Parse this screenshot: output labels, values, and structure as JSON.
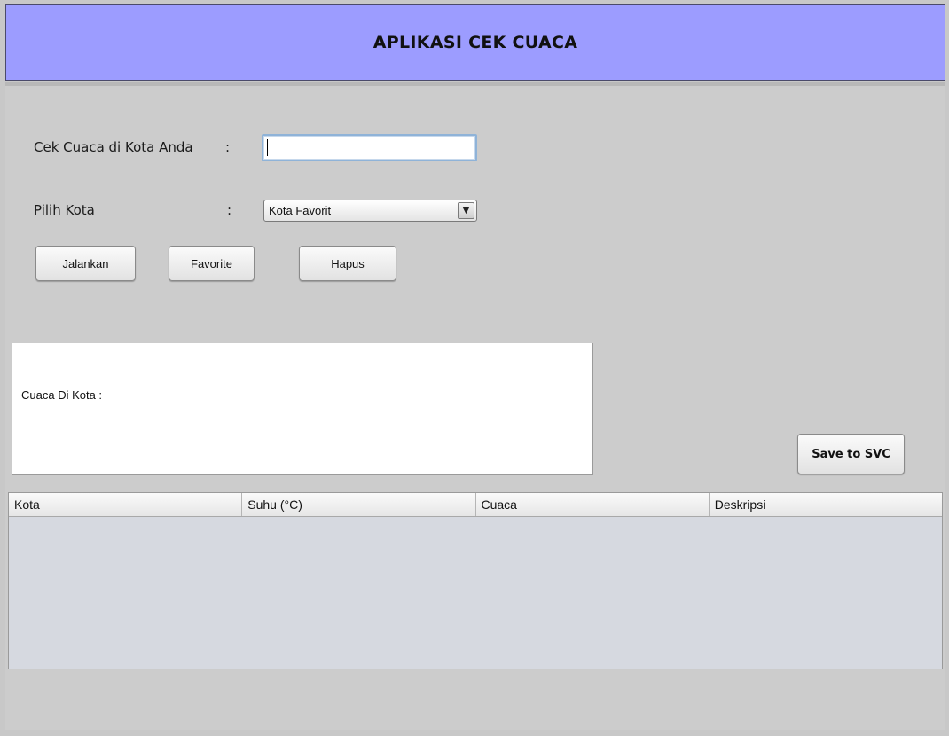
{
  "app": {
    "title": "APLIKASI CEK CUACA"
  },
  "form": {
    "city_label": "Cek Cuaca di Kota Anda",
    "city_colon": ":",
    "city_value": "",
    "pick_label": "Pilih Kota",
    "pick_colon": ":",
    "pick_selected": "Kota Favorit",
    "dropdown_icon": "chevron-down-icon"
  },
  "buttons": {
    "run": "Jalankan",
    "favorite": "Favorite",
    "delete": "Hapus",
    "save": "Save to SVC"
  },
  "result": {
    "label": "Cuaca Di Kota :"
  },
  "table": {
    "columns": [
      "Kota",
      "Suhu (°C)",
      "Cuaca",
      "Deskripsi"
    ],
    "rows": []
  },
  "colors": {
    "header_bg": "#9c9cff",
    "panel_bg": "#cccccc",
    "table_bg": "#d6d9e0"
  }
}
